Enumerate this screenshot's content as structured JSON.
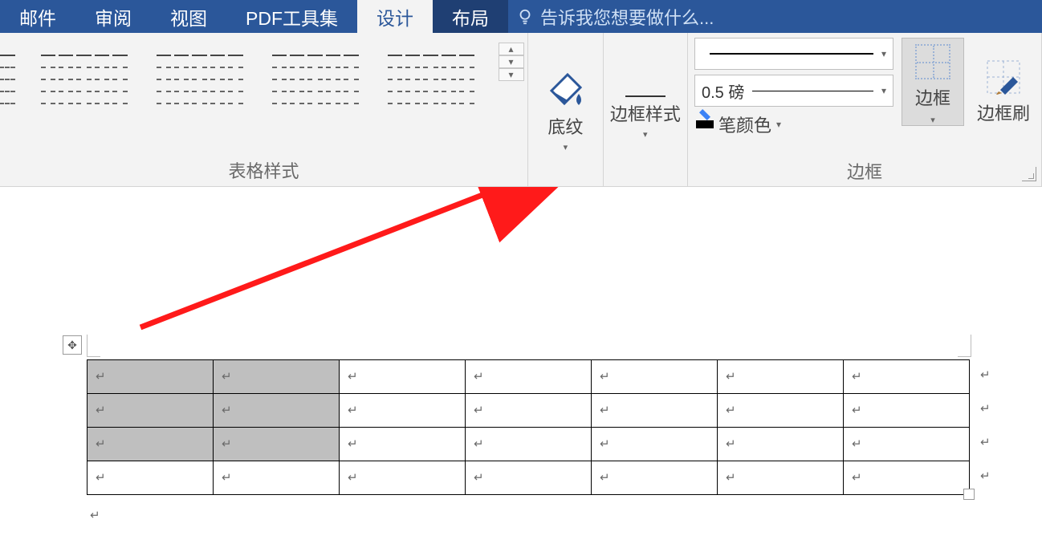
{
  "tabs": {
    "mail": "邮件",
    "review": "审阅",
    "view": "视图",
    "pdf": "PDF工具集",
    "design": "设计",
    "layout": "布局"
  },
  "tellme": {
    "placeholder": "告诉我您想要做什么..."
  },
  "ribbon": {
    "styles_group_label": "表格样式",
    "shading_label": "底纹",
    "border_style_label": "边框样式",
    "border_group_label": "边框",
    "line_weight": "0.5 磅",
    "pen_color_label": "笔颜色",
    "borders_btn": "边框",
    "border_painter_btn": "边框刷"
  },
  "icons": {
    "bulb": "bulb-icon",
    "bucket": "paint-bucket-icon",
    "grid": "border-grid-icon",
    "brush": "border-painter-icon",
    "dropdown": "▾",
    "up": "▴",
    "more": "▾",
    "move": "✥",
    "pmark": "↵"
  },
  "table": {
    "rows": 4,
    "cols": 7,
    "selected": [
      [
        0,
        0
      ],
      [
        0,
        1
      ],
      [
        1,
        0
      ],
      [
        1,
        1
      ],
      [
        2,
        0
      ],
      [
        2,
        1
      ]
    ]
  }
}
